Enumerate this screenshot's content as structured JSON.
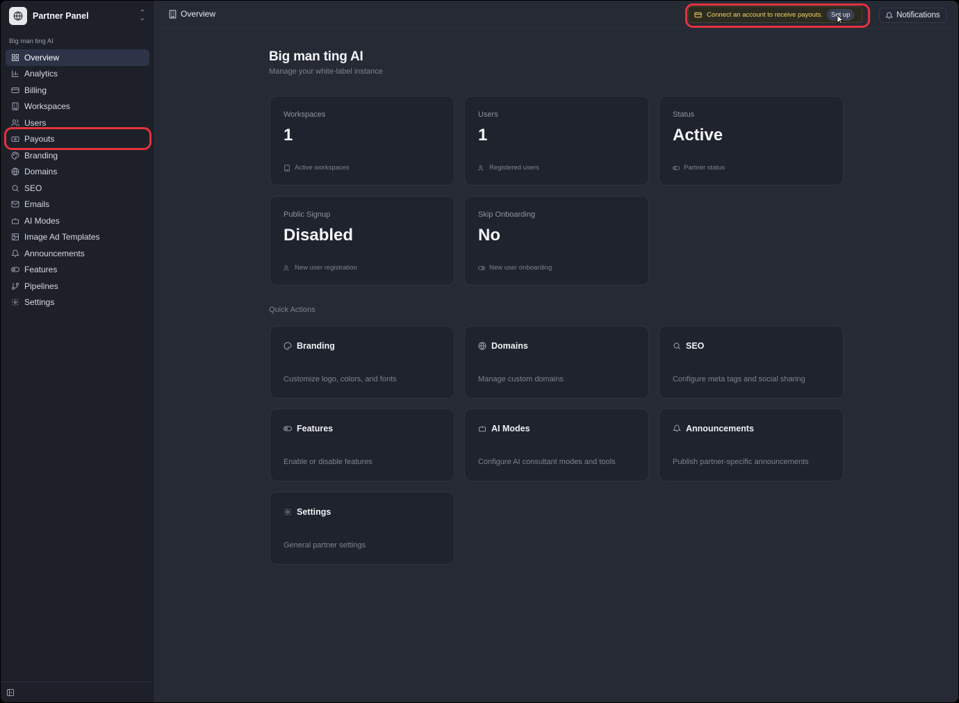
{
  "sidebar": {
    "brand_name": "Partner Panel",
    "org_label": "Big man ting AI",
    "items": [
      {
        "label": "Overview",
        "icon": "grid-icon",
        "active": true
      },
      {
        "label": "Analytics",
        "icon": "bar-chart-icon"
      },
      {
        "label": "Billing",
        "icon": "credit-card-icon"
      },
      {
        "label": "Workspaces",
        "icon": "building-icon"
      },
      {
        "label": "Users",
        "icon": "users-icon"
      },
      {
        "label": "Payouts",
        "icon": "wallet-icon"
      },
      {
        "label": "Branding",
        "icon": "palette-icon"
      },
      {
        "label": "Domains",
        "icon": "globe-icon"
      },
      {
        "label": "SEO",
        "icon": "search-icon"
      },
      {
        "label": "Emails",
        "icon": "mail-icon"
      },
      {
        "label": "AI Modes",
        "icon": "bot-icon"
      },
      {
        "label": "Image Ad Templates",
        "icon": "image-icon"
      },
      {
        "label": "Announcements",
        "icon": "bell-icon"
      },
      {
        "label": "Features",
        "icon": "toggle-icon"
      },
      {
        "label": "Pipelines",
        "icon": "git-branch-icon"
      },
      {
        "label": "Settings",
        "icon": "gear-icon"
      }
    ]
  },
  "topbar": {
    "breadcrumb": "Overview",
    "payout_banner": "Connect an account to receive payouts.",
    "setup_label": "Set up",
    "notifications_label": "Notifications"
  },
  "main": {
    "title": "Big man ting AI",
    "subtitle": "Manage your white-label instance",
    "stats": [
      {
        "label": "Workspaces",
        "value": "1",
        "foot": "Active workspaces"
      },
      {
        "label": "Users",
        "value": "1",
        "foot": "Registered users"
      },
      {
        "label": "Status",
        "value": "Active",
        "foot": "Partner status"
      },
      {
        "label": "Public Signup",
        "value": "Disabled",
        "foot": "New user registration"
      },
      {
        "label": "Skip Onboarding",
        "value": "No",
        "foot": "New user onboarding"
      }
    ],
    "quick_actions_label": "Quick Actions",
    "quick_actions": [
      {
        "title": "Branding",
        "desc": "Customize logo, colors, and fonts"
      },
      {
        "title": "Domains",
        "desc": "Manage custom domains"
      },
      {
        "title": "SEO",
        "desc": "Configure meta tags and social sharing"
      },
      {
        "title": "Features",
        "desc": "Enable or disable features"
      },
      {
        "title": "AI Modes",
        "desc": "Configure AI consultant modes and tools"
      },
      {
        "title": "Announcements",
        "desc": "Publish partner-specific announcements"
      },
      {
        "title": "Settings",
        "desc": "General partner settings"
      }
    ]
  },
  "colors": {
    "highlight": "#e5323e",
    "banner_text": "#f2d26b",
    "active_nav": "#2d3448"
  }
}
